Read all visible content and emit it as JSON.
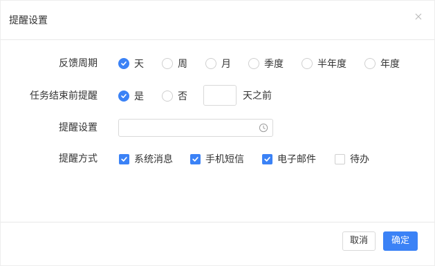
{
  "dialog": {
    "title": "提醒设置"
  },
  "form": {
    "feedback_period": {
      "label": "反馈周期",
      "options": [
        "天",
        "周",
        "月",
        "季度",
        "半年度",
        "年度"
      ],
      "selected": "天"
    },
    "remind_before_end": {
      "label": "任务结束前提醒",
      "options": [
        "是",
        "否"
      ],
      "selected": "是",
      "days_value": "",
      "days_suffix": "天之前"
    },
    "remind_setting": {
      "label": "提醒设置",
      "value": ""
    },
    "remind_method": {
      "label": "提醒方式",
      "options": [
        {
          "label": "系统消息",
          "checked": true
        },
        {
          "label": "手机短信",
          "checked": true
        },
        {
          "label": "电子邮件",
          "checked": true
        },
        {
          "label": "待办",
          "checked": false
        }
      ]
    }
  },
  "footer": {
    "cancel_label": "取消",
    "ok_label": "确定"
  },
  "colors": {
    "accent": "#3b82f6",
    "border": "#d9d9d9"
  },
  "icons": {
    "close": "close-icon",
    "clock": "clock-icon",
    "check": "check-icon"
  }
}
